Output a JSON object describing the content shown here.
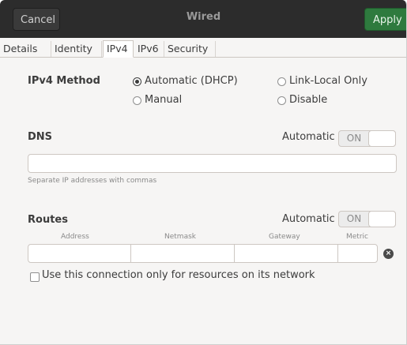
{
  "headerbar": {
    "cancel_label": "Cancel",
    "title": "Wired",
    "apply_label": "Apply"
  },
  "tabs": [
    {
      "label": "Details"
    },
    {
      "label": "Identity"
    },
    {
      "label": "IPv4"
    },
    {
      "label": "IPv6"
    },
    {
      "label": "Security"
    }
  ],
  "ipv4": {
    "method_label": "IPv4 Method",
    "options": [
      {
        "label": "Automatic (DHCP)",
        "checked": true
      },
      {
        "label": "Link-Local Only",
        "checked": false
      },
      {
        "label": "Manual",
        "checked": false
      },
      {
        "label": "Disable",
        "checked": false
      }
    ]
  },
  "dns": {
    "heading": "DNS",
    "automatic_label": "Automatic",
    "switch_label": "ON",
    "value": "",
    "hint": "Separate IP addresses with commas"
  },
  "routes": {
    "heading": "Routes",
    "automatic_label": "Automatic",
    "switch_label": "ON",
    "columns": [
      "Address",
      "Netmask",
      "Gateway",
      "Metric"
    ],
    "delete_icon": "×"
  },
  "restrict_checkbox": {
    "label": "Use this connection only for resources on its network",
    "checked": false
  }
}
